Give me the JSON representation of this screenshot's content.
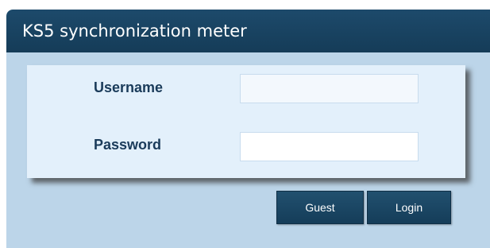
{
  "window": {
    "title": "KS5 synchronization meter"
  },
  "login_form": {
    "username_label": "Username",
    "username_value": "",
    "password_label": "Password",
    "password_value": ""
  },
  "buttons": {
    "guest_label": "Guest",
    "login_label": "Login"
  },
  "colors": {
    "titlebar": "#1d4a6b",
    "panel_background": "#bcd5e9",
    "form_background": "#e3f0fb",
    "label_text": "#1a3b5a",
    "button_background": "#1d4a6b"
  }
}
